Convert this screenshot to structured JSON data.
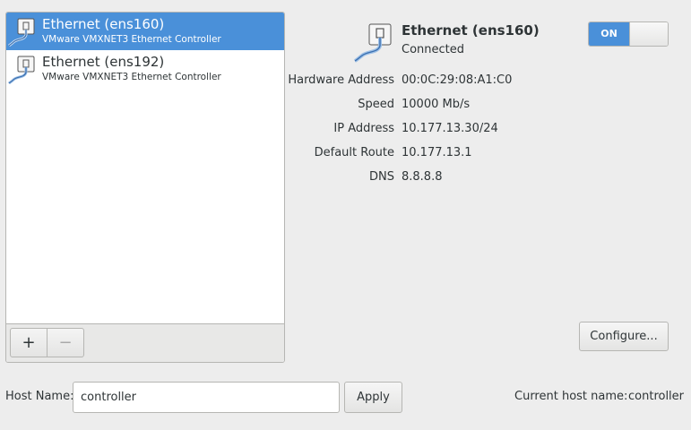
{
  "devices": [
    {
      "name": "Ethernet (ens160)",
      "description": "VMware VMXNET3 Ethernet Controller",
      "selected": true,
      "icon": "ethernet-icon"
    },
    {
      "name": "Ethernet (ens192)",
      "description": "VMware VMXNET3 Ethernet Controller",
      "selected": false,
      "icon": "ethernet-icon"
    }
  ],
  "list_toolbar": {
    "add_label": "+",
    "remove_label": "−"
  },
  "detail": {
    "icon": "ethernet-icon",
    "title": "Ethernet (ens160)",
    "status": "Connected",
    "toggle_label": "ON",
    "toggle_on": true,
    "properties": [
      {
        "label": "Hardware Address",
        "value": "00:0C:29:08:A1:C0"
      },
      {
        "label": "Speed",
        "value": "10000 Mb/s"
      },
      {
        "label": "IP Address",
        "value": "10.177.13.30/24"
      },
      {
        "label": "Default Route",
        "value": "10.177.13.1"
      },
      {
        "label": "DNS",
        "value": "8.8.8.8"
      }
    ],
    "configure_label": "Configure..."
  },
  "hostname": {
    "label": "Host Name:",
    "value": "controller",
    "apply_label": "Apply",
    "current_label": "Current host name:",
    "current_value": "controller"
  },
  "colors": {
    "accent": "#4a90d9",
    "background": "#ededed"
  }
}
